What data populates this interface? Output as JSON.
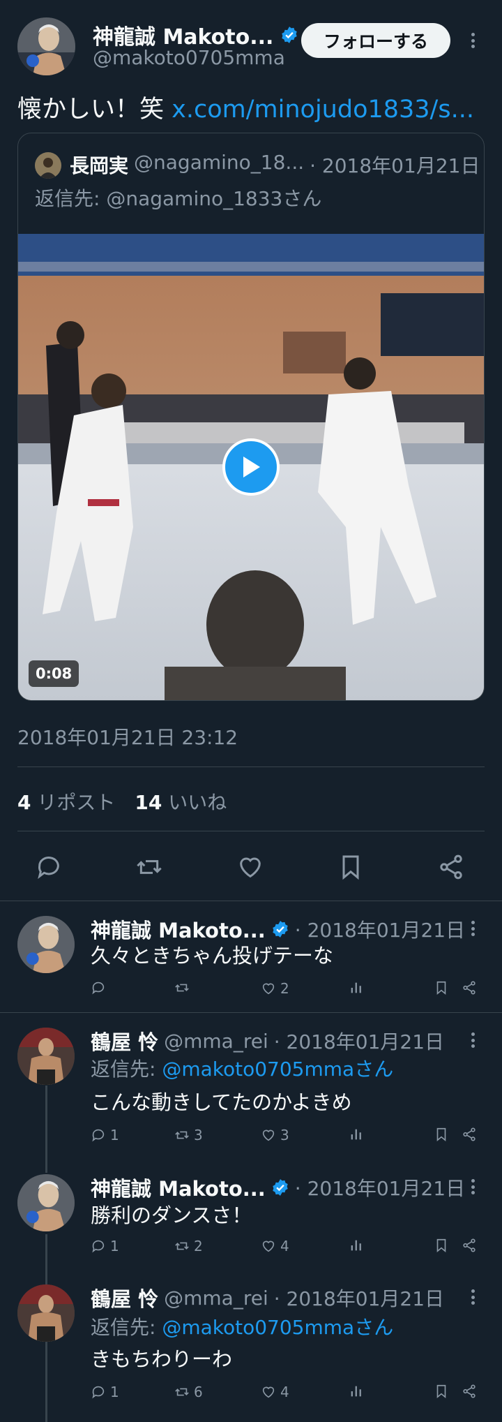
{
  "tweet": {
    "author_name": "神龍誠 Makoto...",
    "author_handle": "@makoto0705mma",
    "follow_label": "フォローする",
    "text": "懐かしい！笑",
    "link_text": "x.com/minojudo1833/s...",
    "timestamp": "2018年01月21日 23:12",
    "reposts_count": "4",
    "reposts_label": "リポスト",
    "likes_count": "14",
    "likes_label": "いいね"
  },
  "quote": {
    "author_name": "長岡実",
    "author_handle": "@nagamino_18...",
    "date": "· 2018年01月21日",
    "reply_to": "返信先: @nagamino_1833さん",
    "video_duration": "0:08"
  },
  "replies": [
    {
      "name": "神龍誠 Makoto...",
      "verified": true,
      "handle": "",
      "date": "· 2018年01月21日",
      "reply_prefix": "",
      "reply_handle": "",
      "text": "久々ときちゃん投げテーな",
      "replies": "",
      "reposts": "",
      "likes": "2"
    },
    {
      "name": "鶴屋 怜",
      "verified": false,
      "handle": "@mma_rei",
      "date": "· 2018年01月21日",
      "reply_prefix": "返信先: ",
      "reply_handle": "@makoto0705mmaさん",
      "text": "こんな動きしてたのかよきめ",
      "replies": "1",
      "reposts": "3",
      "likes": "3"
    },
    {
      "name": "神龍誠 Makoto...",
      "verified": true,
      "handle": "",
      "date": "· 2018年01月21日",
      "reply_prefix": "",
      "reply_handle": "",
      "text": "勝利のダンスさ！",
      "replies": "1",
      "reposts": "2",
      "likes": "4"
    },
    {
      "name": "鶴屋 怜",
      "verified": false,
      "handle": "@mma_rei",
      "date": "· 2018年01月21日",
      "reply_prefix": "返信先: ",
      "reply_handle": "@makoto0705mmaさん",
      "text": "きもちわりーわ",
      "replies": "1",
      "reposts": "6",
      "likes": "4"
    }
  ],
  "icons": [
    "verified-badge-icon",
    "more-icon",
    "reply-icon",
    "repost-icon",
    "like-icon",
    "bookmark-icon",
    "share-icon",
    "views-icon",
    "play-icon"
  ],
  "colors": {
    "background": "#15202b",
    "accent": "#1d9bf0",
    "muted": "#8b98a5",
    "border": "#38444d",
    "text": "#f7f9f9"
  }
}
